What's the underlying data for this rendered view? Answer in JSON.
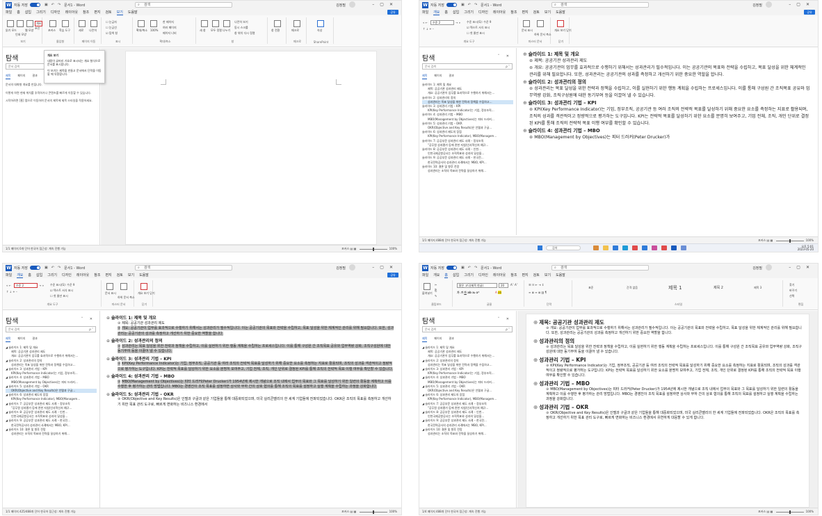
{
  "colors": {
    "accent": "#185abd",
    "highlight": "#d13438",
    "selection": "#bfbfbf",
    "navSelected": "#cfe4f7"
  },
  "titlebar": {
    "autosave": "자동 저장",
    "toggle": "켬",
    "docname": "문서1 - Word",
    "search": "검색",
    "user": "김정필"
  },
  "menu": [
    "파일",
    "보기",
    "홈",
    "삽입",
    "그리기",
    "디자인",
    "레이아웃",
    "참조",
    "편지",
    "검토",
    "보기",
    "도움말"
  ],
  "menu_home_ribbon": [
    "파일",
    "개요",
    "홈",
    "삽입",
    "그리기",
    "디자인",
    "레이아웃",
    "참조",
    "편지",
    "검토",
    "보기",
    "도움말"
  ],
  "share_label": "공유",
  "ribbon_view": {
    "g1": "보기",
    "g2": "몰입형",
    "g3": "페이지 이동",
    "g4": "표시",
    "g5": "확대/축소",
    "g6": "창",
    "g7": "매크로",
    "g8": "SharePoint",
    "b_read": "읽기 모드",
    "b_print": "인쇄 모양",
    "b_web": "웹 모양",
    "b_outline": "개요",
    "b_draft": "초안",
    "b_focus": "포커스",
    "b_reader": "학습 도구",
    "b_vertical": "세로",
    "b_side": "나란히",
    "c_ruler": "눈금자",
    "c_grid": "눈금선",
    "c_nav": "탐색 창",
    "z_zoom": "확대/축소",
    "z_100": "100%",
    "z_one": "한 페이지",
    "z_multi": "여러 페이지",
    "z_width": "페이지 너비",
    "w_new": "새 창",
    "w_arrange": "모두 정렬",
    "w_split": "나누기",
    "w_side": "나란히 보기",
    "w_sync": "동시 스크롤",
    "w_reset": "창 위치 다시 정렬",
    "w_switch": "창 전환",
    "m_macro": "매크로",
    "s_props": "속성"
  },
  "ribbon_outline": {
    "level": "수준 2",
    "level_label": "수준 표시(S): 수준 9",
    "c_format": "텍스트 서식 표시",
    "c_first": "첫 줄만 표시",
    "group_tools": "개요 도구",
    "b_show": "문서 표시",
    "b_collapse": "하위 문서 축소",
    "group_master": "마스터 문서",
    "b_close": "개요 보기 닫기",
    "group_close": "닫기"
  },
  "ribbon_home": {
    "clipboard": "클립보드",
    "paste": "붙여넣기",
    "font": "맑은 고딕(제목 한글)",
    "font_group": "글꼴",
    "para_group": "단락",
    "style_group": "스타일",
    "edit_group": "편집",
    "s_normal": "표준",
    "s_nospace": "간격 없음",
    "s_h1": "제목 1",
    "s_h2": "제목 2",
    "s_h3": "제목 3",
    "e_find": "찾기",
    "e_replace": "바꾸기",
    "e_select": "선택"
  },
  "tooltip": {
    "title": "개요 보기",
    "p1": "내용이 글머리 기호로 표시되는 개요 형식으로 문서를 표시합니다.",
    "p2": "이 보기는 제목을 만들고 문서에서 단락을 이동할 때 유용합니다."
  },
  "nav": {
    "title": "탐색",
    "search": "문서 검색",
    "tabs": [
      "제목",
      "페이지",
      "결과"
    ],
    "empty": [
      "문서의 대화형 개요를 만듭니다.",
      "이렇게 하면 현재 위치를 추적하거나 콘텐츠를 빠르게 이동할 수 있습니다.",
      "시작하려면 [홈] 탭으로 이동하여 문서의 제목에 제목 스타일을 적용하세요."
    ]
  },
  "nav_items": [
    {
      "t": "슬라이드 1: 제목 및 개요",
      "lv": 1
    },
    {
      "t": "제목: 공공기관 성과관리 제도",
      "lv": 2
    },
    {
      "t": "개요: 공공기관이 업무를 효과적으로 수행하기 위해서는…",
      "lv": 2
    },
    {
      "t": "슬라이드 2: 성과관리의 정의",
      "lv": 1
    },
    {
      "t": "성과관리는 목표 달성을 위한 전략과 정책을 수립하고…",
      "lv": 2
    },
    {
      "t": "슬라이드 3: 성과관리 기법 – KPI",
      "lv": 1
    },
    {
      "t": "KPI(Key Performance Indicator)는 기업, 정부조직…",
      "lv": 2
    },
    {
      "t": "슬라이드 4: 성과관리 기법 – MBO",
      "lv": 1
    },
    {
      "t": "MBO(Management by Objectives)는 피터 드러커…",
      "lv": 2
    },
    {
      "t": "슬라이드 5: 성과관리 기법 – OKR",
      "lv": 1
    },
    {
      "t": "OKR(Objective and Key Results)은 인텔과 구글…",
      "lv": 2
    },
    {
      "t": "슬라이드 6: 성과관리 제도의 장점",
      "lv": 1
    },
    {
      "t": "KPI(Key Performance Indicator), MBO(Managem…",
      "lv": 2
    },
    {
      "t": "슬라이드 7: 공공부문 성과관리 제도 사례 – 정부조직",
      "lv": 1
    },
    {
      "t": "\"공무원 성과평가 등에 관한 지침(인사혁신처 예규…",
      "lv": 2
    },
    {
      "t": "슬라이드 8: 공공부문 성과관리 제도 사례 – 인천…",
      "lv": 1
    },
    {
      "t": "인천국제공항공사는 조직목표와 성과의 달성을…",
      "lv": 2
    },
    {
      "t": "슬라이드 9: 공공부문 성과관리 제도 사례 – 한국전…",
      "lv": 1
    },
    {
      "t": "한국전력공사의 성과관리 사례에서는 MBO, KPI…",
      "lv": 2
    },
    {
      "t": "슬라이드 10: 결론 및 향후 전망",
      "lv": 1
    },
    {
      "t": "성과관리는 조직의 목표와 전략을 달성하기 위해…",
      "lv": 2
    }
  ],
  "doc_q2": [
    {
      "h": true,
      "t": "슬라이드 1: 제목 및 개요"
    },
    {
      "h": false,
      "t": "제목: 공공기관 성과관리 제도"
    },
    {
      "h": false,
      "t": "개요: 공공기관이 업무를 효과적으로 수행하기 위해서는 성과관리가 필수적입니다. 이는 공공기관의 목표와 전략을 수립하고, 목표 달성을 위한 체계적인 관리를 위해 필요합니다. 또한, 성과관리는 공공기관의 성과를 측정하고 개선하기 위한 중요한 역할을 합니다."
    },
    {
      "h": true,
      "t": "슬라이드 2: 성과관리의 정의"
    },
    {
      "h": false,
      "t": "성과관리는 목표 달성을 위한 전략과 정책을 수립하고, 이를 실현하기 위한 행동 계획을 수립하는 프로세스입니다. 이를 통해 구성원 간 조직목표 공유와 업무역량 강화, 조직구성원에 대한 동기부여 등을 이끌어 낼 수 있습니다."
    },
    {
      "h": true,
      "t": "슬라이드 3: 성과관리 기법 – KPI"
    },
    {
      "h": false,
      "t": "KPI(Key Performance Indicator)는 기업, 정부조직, 공공기관 등 여러 조직의 전략적 목표를 달성하기 위해 중요한 요소를 측정하는 지표로 활용되며, 조직의 성과를 객관적이고 정량적으로 평가하는 도구입니다. KPI는 전략적 목표를 달성하기 위한 요소를 분명히 보여주고, 기업 전체, 조직, 개인 단위로 결정된 KPI를 통해 조직의 전략적 목표 이행 여부를 확인할 수 있습니다."
    },
    {
      "h": true,
      "t": "슬라이드 4: 성과관리 기법 – MBO"
    },
    {
      "h": false,
      "t": "MBO(Management by Objectives)는 피터 드러커(Peter Drucker)가"
    }
  ],
  "doc_q3": [
    {
      "h": true,
      "t": "슬라이드 1: 제목 및 개요"
    },
    {
      "h": false,
      "t": "제목: 공공기관 성과관리 제도"
    },
    {
      "h": false,
      "sel": true,
      "t": "개요: 공공기관이 업무를 효과적으로 수행하기 위해서는 성과관리가 필수적입니다. 이는 공공기관의 목표와 전략을 수립하고, 목표 달성을 위한 체계적인 관리를 위해 필요합니다. 또한, 성과관리는 공공기관의 성과를 측정하고 개선하기 위한 중요한 역할을 합니다."
    },
    {
      "h": true,
      "t": "슬라이드 2: 성과관리의 정의"
    },
    {
      "h": false,
      "sel": true,
      "t": "성과관리는 목표 달성을 위한 전략과 정책을 수립하고, 이를 실현하기 위한 행동 계획을 수립하는 프로세스입니다. 이를 통해 구성원 간 조직목표 공유와 업무역량 강화, 조직구성원에 대한 동기부여 등을 이끌어 낼 수 있습니다."
    },
    {
      "h": true,
      "t": "슬라이드 3: 성과관리 기법 – KPI"
    },
    {
      "h": false,
      "sel": true,
      "t": "KPI(Key Performance Indicator)는 기업, 정부조직, 공공기관 등 여러 조직의 전략적 목표를 달성하기 위해 중요한 요소를 측정하는 지표로 활용되며, 조직의 성과를 객관적이고 정량적으로 평가하는 도구입니다. KPI는 전략적 목표를 달성하기 위한 요소를 분명히 보여주고, 기업 전체, 조직, 개인 단위로 결정된 KPI를 통해 조직의 전략적 목표 이행 여부를 확인할 수 있습니다."
    },
    {
      "h": true,
      "t": "슬라이드 4: 성과관리 기법 – MBO"
    },
    {
      "h": false,
      "sel": true,
      "t": "MBO(Management by Objectives)는 피터 드러커(Peter Drucker)가 1954년에 제시한 개념으로 조직 내에서 업무의 목표와 그 목표를 달성하기 위한 일련의 활동을 계획하고 이를 수행한 후 평가하는 관리 방법입니다. MBO는 경영진이 조직 목표를 설정하면 상사와 부하 간의 상호 협의를 통해 조직의 목표를 설정하고 실행 계획을 수립하는 과정을 강화합니다."
    },
    {
      "h": true,
      "t": "슬라이드 5: 성과관리 기법 – OKR"
    },
    {
      "h": false,
      "t": "OKR(Objective and Key Results)은 인텔과 구글과 같은 기업들을 통해 대중화되었으며, 미국 실리콘밸리의 한 세계 기업들에 전파되었습니다. OKR은 조직의 목표를 측정하고 개선하기 위한 목표 관리 도구로, 빠르게 변화하는 비즈니스 환경에서"
    }
  ],
  "doc_q4": [
    {
      "h": true,
      "t": "제목: 공공기관 성과관리 제도"
    },
    {
      "h": false,
      "t": "개요: 공공기관이 업무를 효과적으로 수행하기 위해서는 성과관리가 필수적입니다. 이는 공공기관의 목표와 전략을 수립하고, 목표 달성을 위한 체계적인 관리를 위해 필요합니다. 또한, 성과관리는 공공기관의 성과를 측정하고 개선하기 위한 중요한 역할을 합니다."
    },
    {
      "h": true,
      "t": "성과관리의 정의"
    },
    {
      "h": false,
      "t": "성과관리는 목표 달성을 위한 전략과 정책을 수립하고, 이를 실현하기 위한 행동 계획을 수립하는 프로세스입니다. 이를 통해 구성원 간 조직목표 공유와 업무역량 강화, 조직구성원에 대한 동기부여 등을 이끌어 낼 수 있습니다."
    },
    {
      "h": true,
      "t": "성과관리 기법 – KPI"
    },
    {
      "h": false,
      "t": "KPI(Key Performance Indicator)는 기업, 정부조직, 공공기관 등 여러 조직의 전략적 목표를 달성하기 위해 중요한 요소를 측정하는 지표로 활용되며, 조직의 성과를 객관적이고 정량적으로 평가하는 도구입니다. KPI는 전략적 목표를 달성하기 위한 요소를 분명히 보여주고, 기업 전체, 조직, 개인 단위로 결정된 KPI를 통해 조직의 전략적 목표 이행 여부를 확인할 수 있습니다."
    },
    {
      "h": true,
      "t": "성과관리 기법 – MBO"
    },
    {
      "h": false,
      "t": "MBO(Management by Objectives)는 피터 드러커(Peter Drucker)가 1954년에 제시한 개념으로 조직 내에서 업무의 목표와 그 목표를 달성하기 위한 일련의 활동을 계획하고 이를 수행한 후 평가하는 관리 방법입니다. MBO는 경영진이 조직 목표를 설정하면 상사와 부하 간의 상호 협의를 통해 조직의 목표를 설정하고 실행 계획을 수립하는 과정을 강화합니다."
    },
    {
      "h": true,
      "t": "성과관리 기법 – OKR"
    },
    {
      "h": false,
      "t": "OKR(Objective and Key Results)은 인텔과 구글과 같은 기업들을 통해 대중화되었으며, 미국 실리콘밸리의 한 세계 기업들에 전파되었습니다. OKR은 조직의 목표를 측정하고 개선하기 위한 목표 관리 도구로, 빠르게 변화하는 비즈니스 환경에서 유연하게 대응할 수 있게 합니다."
    }
  ],
  "status": {
    "q1": "1/1 페이지   0개 단어   한국어   접근성: 계속 진행 가능",
    "q2": "1/1 페이지   488개 단어   한국어   접근성: 계속 진행 가능",
    "q3": "1/1 페이지   425/488개 단어   한국어   접근성: 계속 진행 가능",
    "q4": "1/4 페이지   488개 단어   한국어   접근성: 계속 진행 가능",
    "focus": "포커스",
    "zoom": "100%"
  },
  "taskbar": {
    "search": "검색",
    "time": "오후 5:01",
    "date": "2023-05-20"
  }
}
